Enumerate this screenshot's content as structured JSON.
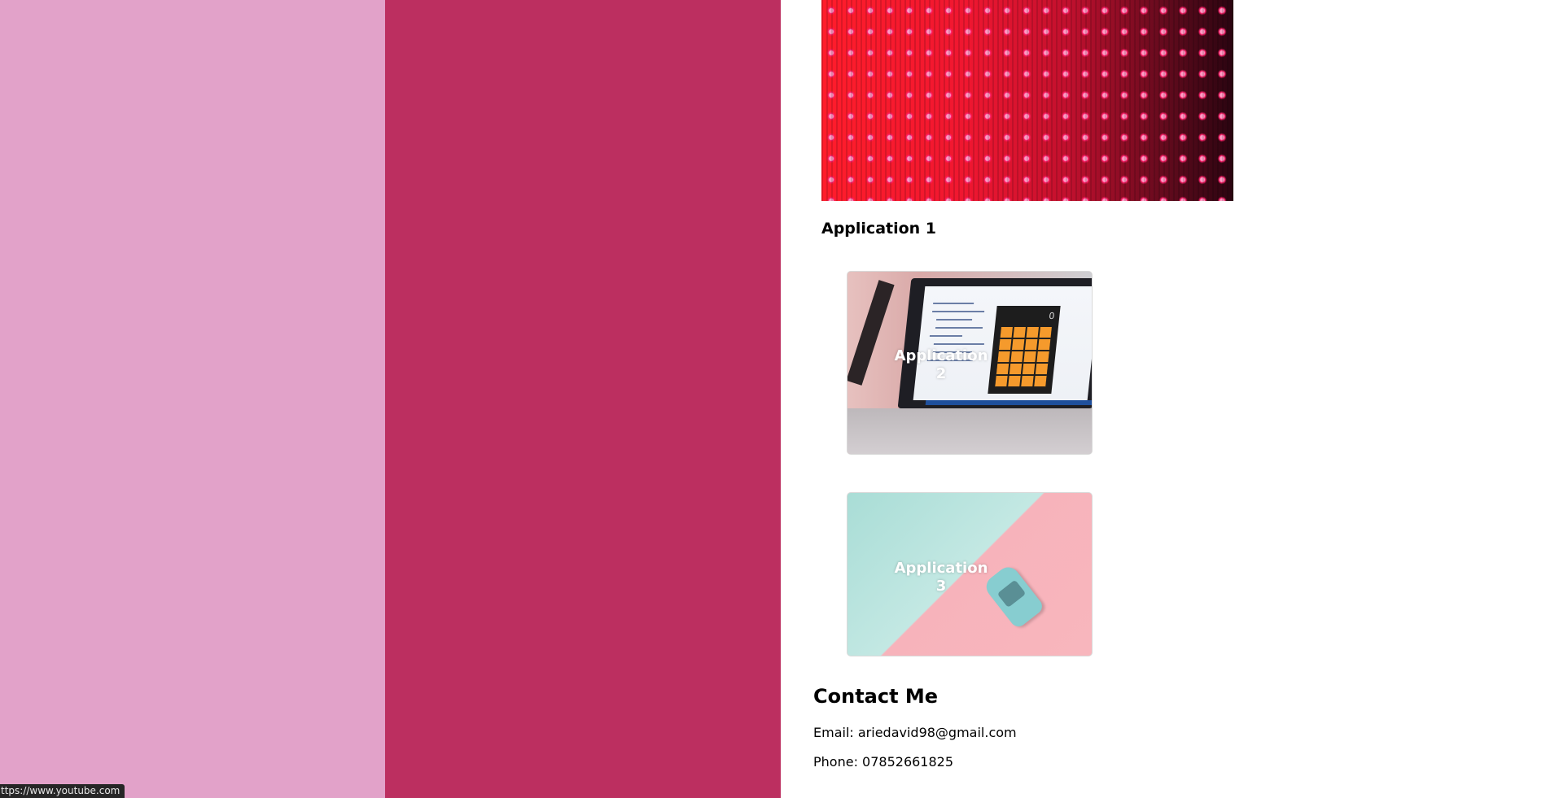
{
  "colors": {
    "left_column": "#e2a2c9",
    "middle_column": "#bc2f60",
    "page_background": "#ffffff"
  },
  "applications": [
    {
      "title": "Application 1",
      "image": "red-led-wall-image"
    },
    {
      "title": "Application 2",
      "image": "laptop-calculator-image"
    },
    {
      "title": "Application 3",
      "image": "toy-car-image"
    }
  ],
  "contact": {
    "heading": "Contact Me",
    "email": "Email: ariedavid98@gmail.com",
    "phone": "Phone: 07852661825"
  },
  "status_bar": {
    "url": "ttps://www.youtube.com"
  }
}
